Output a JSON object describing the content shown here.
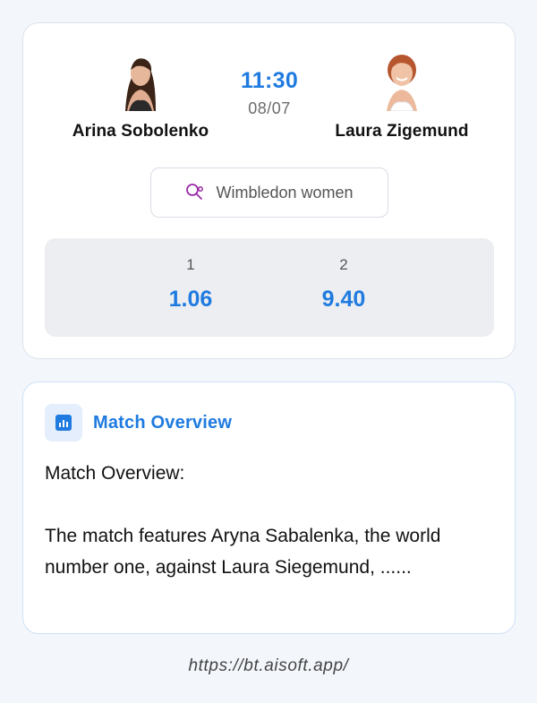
{
  "match": {
    "home": {
      "name": "Arina Sobolenko"
    },
    "away": {
      "name": "Laura Zigemund"
    },
    "time": "11:30",
    "date": "08/07",
    "tournament": "Wimbledon women",
    "odds": [
      {
        "label": "1",
        "value": "1.06"
      },
      {
        "label": "2",
        "value": "9.40"
      }
    ]
  },
  "overview": {
    "title": "Match Overview",
    "body": "Match Overview:\n\nThe match features Aryna Sabalenka, the world number one, against Laura Siegemund, ......"
  },
  "footer": {
    "url": "https://bt.aisoft.app/"
  },
  "colors": {
    "accent": "#1f7be0",
    "tournament_icon": "#9b2aa8"
  },
  "icons": {
    "tournament": "tennis-racket-icon",
    "overview": "bar-chart-icon"
  }
}
